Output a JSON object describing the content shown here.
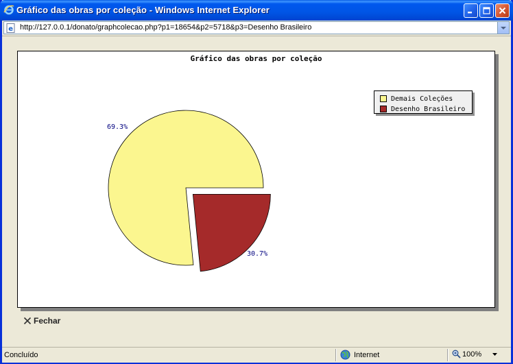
{
  "window": {
    "title": "Gráfico das obras por coleção - Windows Internet Explorer"
  },
  "address_bar": {
    "url": "http://127.0.0.1/donato/graphcolecao.php?p1=18654&p2=5718&p3=Desenho Brasileiro"
  },
  "chart_data": {
    "type": "pie",
    "title": "Gráfico das obras por coleção",
    "slices": [
      {
        "name": "Demais Coleções",
        "value": 18654,
        "percent_label": "69.3%",
        "color": "#fbf68f",
        "exploded": false
      },
      {
        "name": "Desenho Brasileiro",
        "value": 5718,
        "percent_label": "30.7%",
        "color": "#a52a2a",
        "exploded": true
      }
    ],
    "legend_position": "top-right"
  },
  "content": {
    "close_label": "Fechar"
  },
  "status_bar": {
    "status": "Concluído",
    "zone": "Internet",
    "zoom": "100%"
  }
}
